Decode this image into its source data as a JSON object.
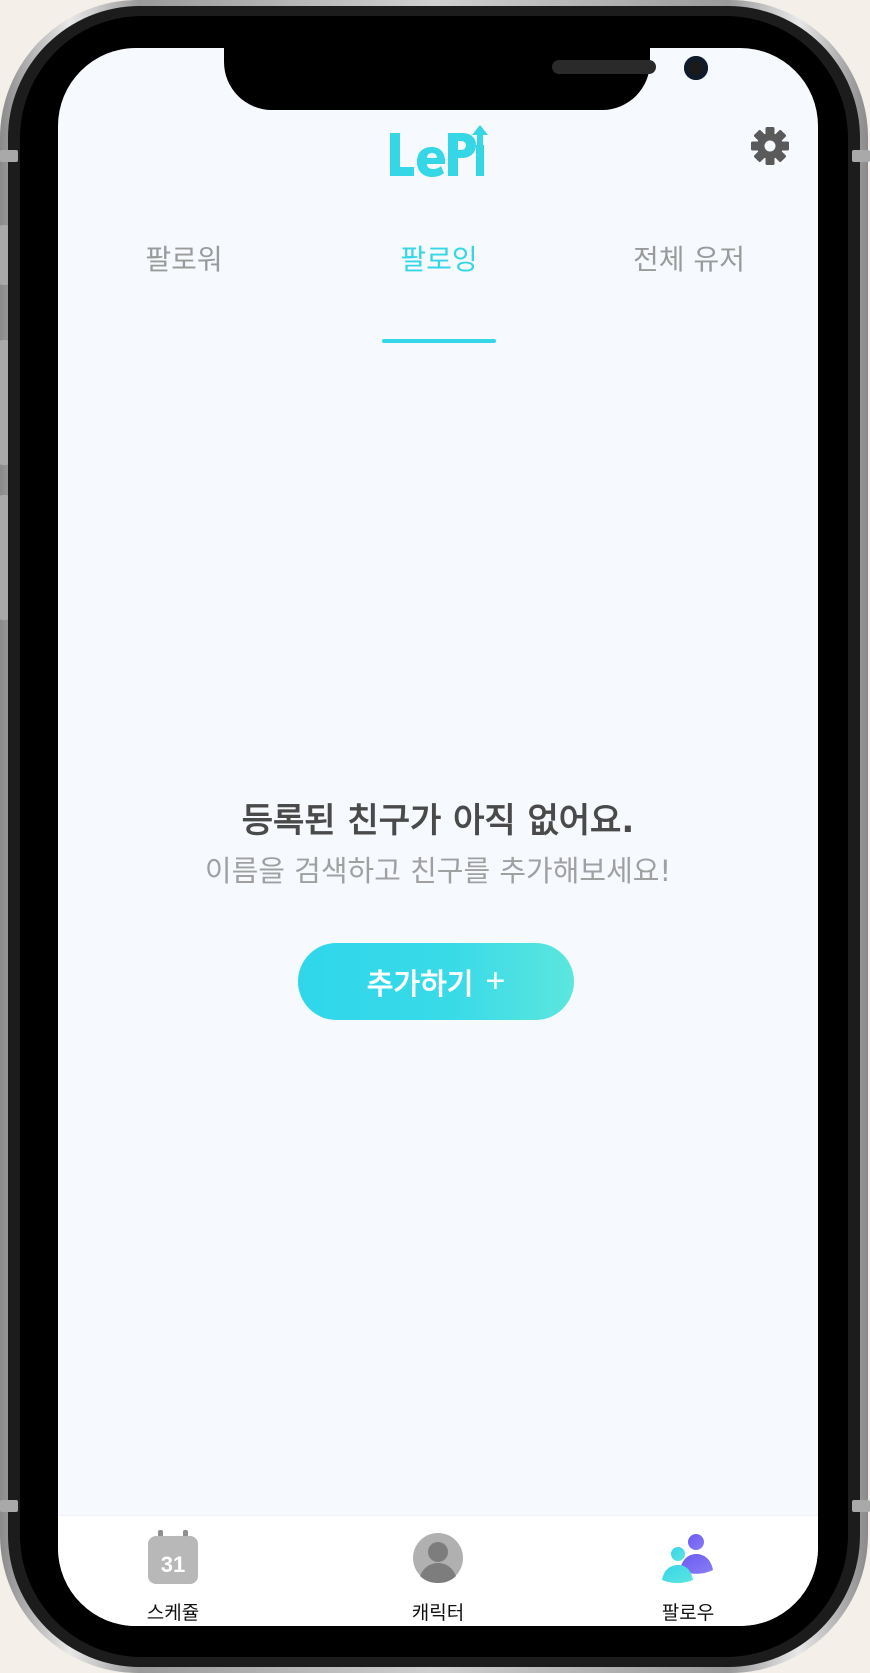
{
  "header": {
    "logo_text": "LePI",
    "settings_icon": "gear-icon"
  },
  "tabs": [
    {
      "label": "팔로워",
      "active": false
    },
    {
      "label": "팔로잉",
      "active": true
    },
    {
      "label": "전체 유저",
      "active": false
    }
  ],
  "empty_state": {
    "title": "등록된 친구가 아직 없어요.",
    "subtitle": "이름을 검색하고 친구를 추가해보세요!",
    "button_label": "추가하기",
    "button_icon": "+"
  },
  "bottom_nav": [
    {
      "label": "스케쥴",
      "icon": "calendar-icon",
      "calendar_day": "31"
    },
    {
      "label": "캐릭터",
      "icon": "person-icon"
    },
    {
      "label": "팔로우",
      "icon": "people-icon"
    }
  ],
  "colors": {
    "accent": "#35d6e6",
    "button_gradient_start": "#2fd6ea",
    "button_gradient_end": "#5ce6de",
    "screen_bg": "#f6faff"
  }
}
